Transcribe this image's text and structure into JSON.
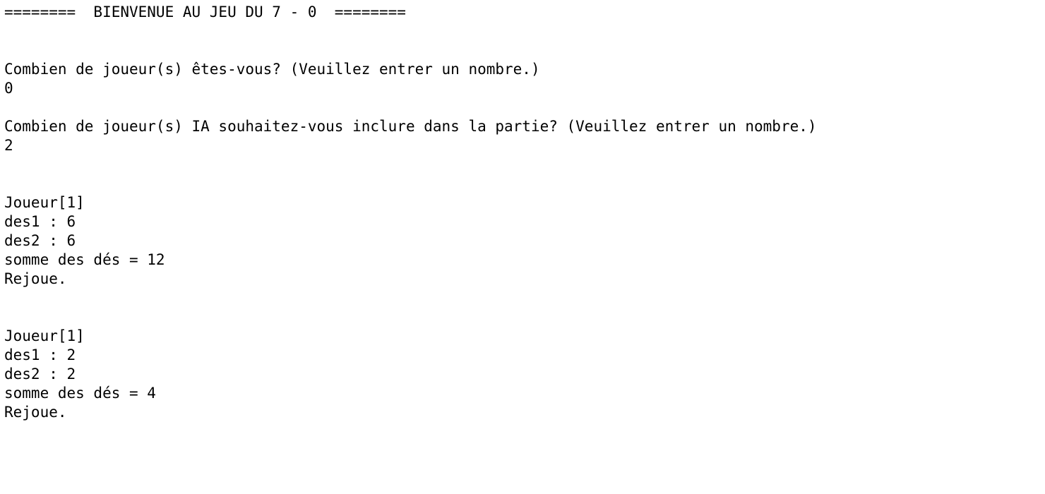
{
  "console": {
    "banner": "========  BIENVENUE AU JEU DU 7 - 0  ========",
    "prompt_players": "Combien de joueur(s) êtes-vous? (Veuillez entrer un nombre.)",
    "input_players": "0",
    "prompt_ai_players": "Combien de joueur(s) IA souhaitez-vous inclure dans la partie? (Veuillez entrer un nombre.)",
    "input_ai_players": "2",
    "turns": [
      {
        "player": "Joueur[1]",
        "des1": "des1 : 6",
        "des2": "des2 : 6",
        "somme": "somme des dés = 12",
        "result": "Rejoue."
      },
      {
        "player": "Joueur[1]",
        "des1": "des1 : 2",
        "des2": "des2 : 2",
        "somme": "somme des dés = 4",
        "result": "Rejoue."
      }
    ]
  }
}
